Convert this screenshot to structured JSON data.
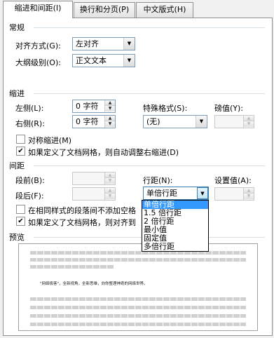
{
  "tabs": [
    "缩进和间距(I)",
    "换行和分页(P)",
    "中文版式(H)"
  ],
  "general": {
    "title": "常规",
    "alignment_label": "对齐方式(G):",
    "alignment_value": "左对齐",
    "outline_label": "大纲级别(O):",
    "outline_value": "正文文本"
  },
  "indent": {
    "title": "缩进",
    "left_label": "左侧(L):",
    "left_value": "0 字符",
    "right_label": "右侧(R):",
    "right_value": "0 字符",
    "special_label": "特殊格式(S):",
    "special_value": "(无)",
    "measure_label": "磅值(Y):",
    "measure_value": "",
    "mirror_label": "对称缩进(M)",
    "mirror_checked": false,
    "grid_label": "如果定义了文档网格，则自动调整右缩进(D)",
    "grid_checked": true
  },
  "spacing": {
    "title": "间距",
    "before_label": "段前(B):",
    "before_value": "",
    "after_label": "段后(F):",
    "after_value": "",
    "line_label": "行距(N):",
    "line_value": "单倍行距",
    "setting_label": "设置值(A):",
    "setting_value": "",
    "no_space_label": "在相同样式的段落间不添加空格",
    "no_space_checked": false,
    "snap_label": "如果定义了文档网格，则对齐到",
    "snap_checked": true
  },
  "line_spacing_options": [
    "单倍行距",
    "1.5 倍行距",
    "2 倍行距",
    "最小值",
    "固定值",
    "多倍行距"
  ],
  "line_spacing_selected_index": 0,
  "preview": {
    "title": "预览",
    "sample_text": "\"网络极客\"，全新视角，全新思维，向你整理神奇的网络世界。"
  }
}
